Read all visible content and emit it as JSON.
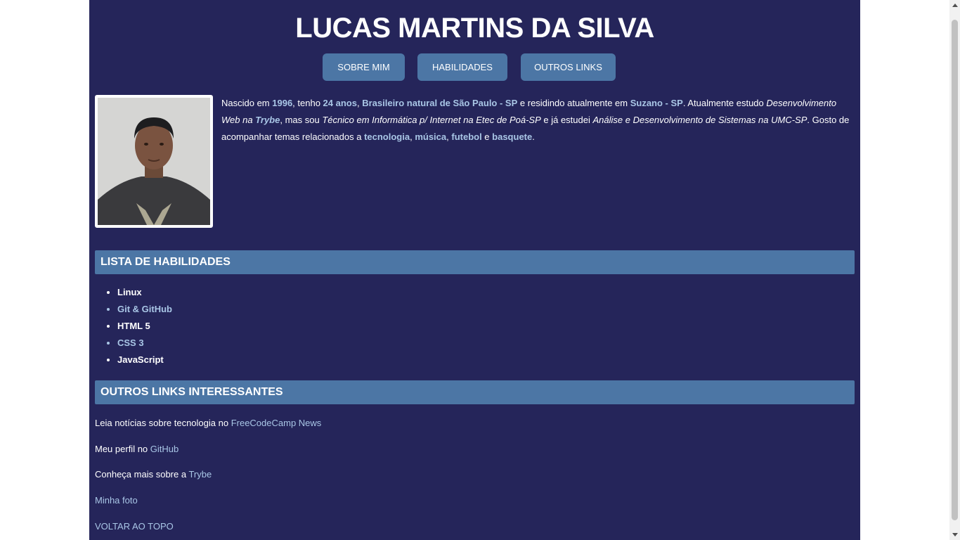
{
  "header": {
    "title": "LUCAS MARTINS DA SILVA",
    "nav": [
      "SOBRE MIM",
      "HABILIDADES",
      "OUTROS LINKS"
    ]
  },
  "about": {
    "photo_alt": "Minha foto",
    "bio": [
      {
        "t": "Nascido em "
      },
      {
        "t": "1996",
        "s": "hl"
      },
      {
        "t": ", tenho "
      },
      {
        "t": "24 anos",
        "s": "hl"
      },
      {
        "t": ", "
      },
      {
        "t": "Brasileiro natural de São Paulo - SP",
        "s": "hl"
      },
      {
        "t": " e residindo atualmente em "
      },
      {
        "t": "Suzano - SP",
        "s": "hl"
      },
      {
        "t": ". Atualmente estudo "
      },
      {
        "t": "Desenvolvimento Web na ",
        "s": "i"
      },
      {
        "t": "Trybe",
        "s": "hli"
      },
      {
        "t": ", mas sou "
      },
      {
        "t": "Técnico em Informática p/ Internet na Etec de Poá-SP",
        "s": "i"
      },
      {
        "t": " e já estudei "
      },
      {
        "t": "Análise e Desenvolvimento de Sistemas na UMC-SP",
        "s": "i"
      },
      {
        "t": ". Gosto de acompanhar temas relacionados a "
      },
      {
        "t": "tecnologia",
        "s": "hl"
      },
      {
        "t": ", "
      },
      {
        "t": "música",
        "s": "hl"
      },
      {
        "t": ", "
      },
      {
        "t": "futebol",
        "s": "hl"
      },
      {
        "t": " e "
      },
      {
        "t": "basquete",
        "s": "hl"
      },
      {
        "t": "."
      }
    ]
  },
  "skills": {
    "heading": "LISTA DE HABILIDADES",
    "items": [
      "Linux",
      "Git & GitHub",
      "HTML 5",
      "CSS 3",
      "JavaScript"
    ]
  },
  "links": {
    "heading": "OUTROS LINKS INTERESSANTES",
    "freecodecamp_prefix": "Leia notícias sobre tecnologia no ",
    "freecodecamp_link": "FreeCodeCamp News",
    "github_prefix": "Meu perfil no ",
    "github_link": "GitHub",
    "trybe_prefix": "Conheça mais sobre a ",
    "trybe_link": "Trybe",
    "photo_link": "Minha foto",
    "back_to_top": "VOLTAR AO TOPO"
  },
  "colors": {
    "background": "#25255a",
    "accent": "#4c76a5",
    "link": "#a9c6e6"
  }
}
